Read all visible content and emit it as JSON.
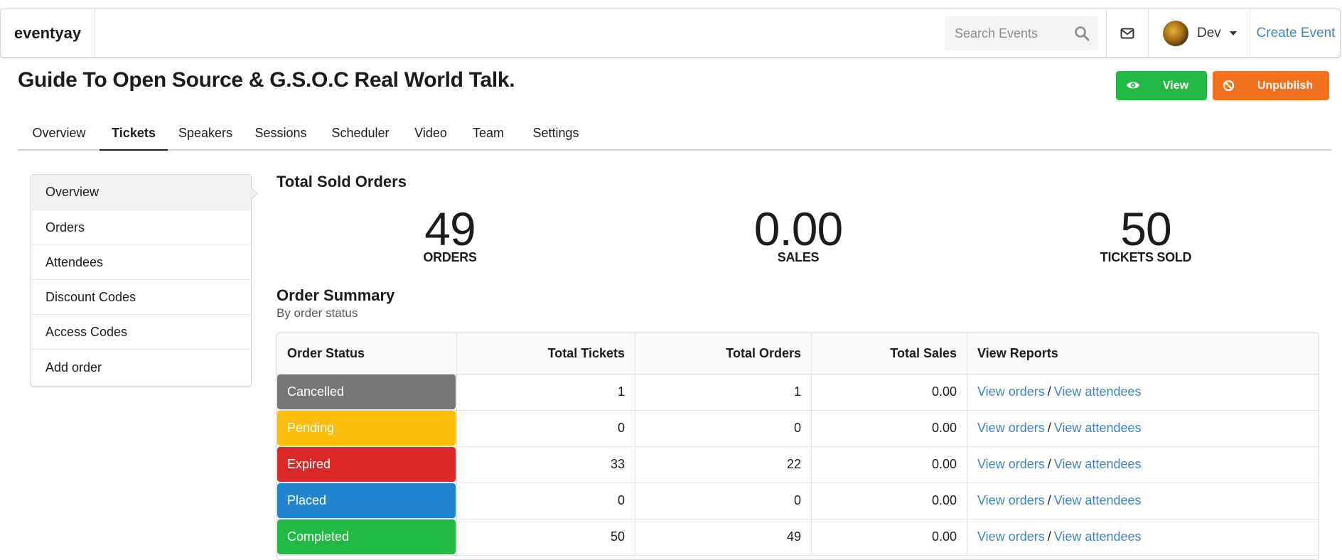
{
  "navbar": {
    "brand": "eventyay",
    "search_placeholder": "Search Events",
    "user_name": "Dev",
    "create_event": "Create Event"
  },
  "event": {
    "title": "Guide To Open Source & G.S.O.C Real World Talk.",
    "view_label": "View",
    "unpublish_label": "Unpublish"
  },
  "tabs": [
    "Overview",
    "Tickets",
    "Speakers",
    "Sessions",
    "Scheduler",
    "Video",
    "Team",
    "Settings"
  ],
  "active_tab": "Tickets",
  "side_menu": [
    "Overview",
    "Orders",
    "Attendees",
    "Discount Codes",
    "Access Codes",
    "Add order"
  ],
  "active_side": "Overview",
  "sold": {
    "heading": "Total Sold Orders",
    "orders_value": "49",
    "orders_label": "ORDERS",
    "sales_value": "0.00",
    "sales_label": "SALES",
    "tickets_value": "50",
    "tickets_label": "TICKETS SOLD"
  },
  "summary": {
    "heading": "Order Summary",
    "subheading": "By order status",
    "columns": [
      "Order Status",
      "Total Tickets",
      "Total Orders",
      "Total Sales",
      "View Reports"
    ],
    "view_orders": "View orders",
    "view_attendees": "View attendees",
    "rows": [
      {
        "status": "Cancelled",
        "tickets": "1",
        "orders": "1",
        "sales": "0.00",
        "color": "#767676"
      },
      {
        "status": "Pending",
        "tickets": "0",
        "orders": "0",
        "sales": "0.00",
        "color": "#fbbd08"
      },
      {
        "status": "Expired",
        "tickets": "33",
        "orders": "22",
        "sales": "0.00",
        "color": "#db2828"
      },
      {
        "status": "Placed",
        "tickets": "0",
        "orders": "0",
        "sales": "0.00",
        "color": "#2185d0"
      },
      {
        "status": "Completed",
        "tickets": "50",
        "orders": "49",
        "sales": "0.00",
        "color": "#21ba45"
      }
    ]
  },
  "colors": {
    "view_button": "#21ba45",
    "unpublish_button": "#f2711c",
    "link": "#4183c4"
  },
  "icons": [
    "search-icon",
    "mail-icon",
    "chevron-down-icon",
    "eye-icon",
    "ban-icon"
  ]
}
